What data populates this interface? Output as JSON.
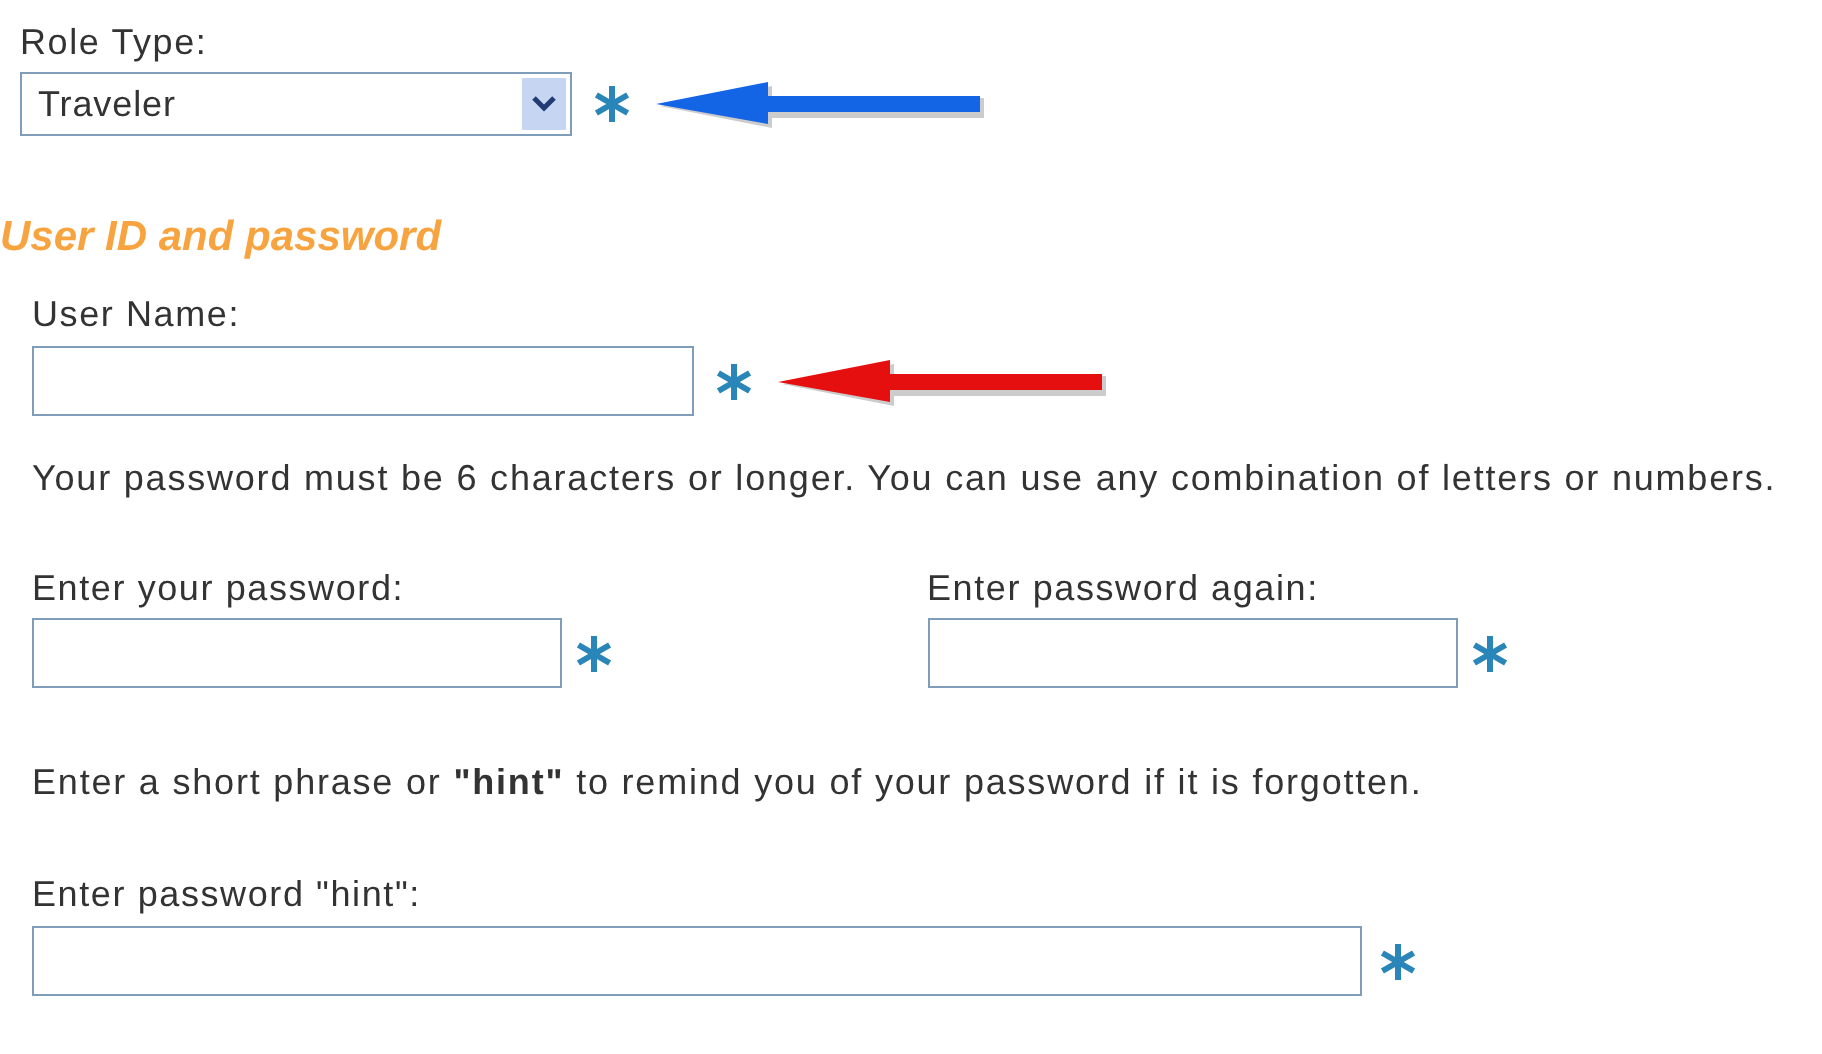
{
  "role_type": {
    "label": "Role Type:",
    "value": "Traveler",
    "arrow": {
      "color": "#1464e6"
    }
  },
  "section_heading": "User ID and password",
  "user_name": {
    "label": "User Name:",
    "arrow": {
      "color": "#e60f0f"
    }
  },
  "password_note": "Your password must be 6 characters or longer. You can use any combination of letters or numbers.",
  "password_fields": [
    {
      "label": "Enter your password:"
    },
    {
      "label": "Enter password again:"
    }
  ],
  "hint_note": "Enter a short phrase or **\"hint\"**  to remind you of your password if it is forgotten.",
  "hint_field": {
    "label": "Enter password \"hint\":"
  }
}
